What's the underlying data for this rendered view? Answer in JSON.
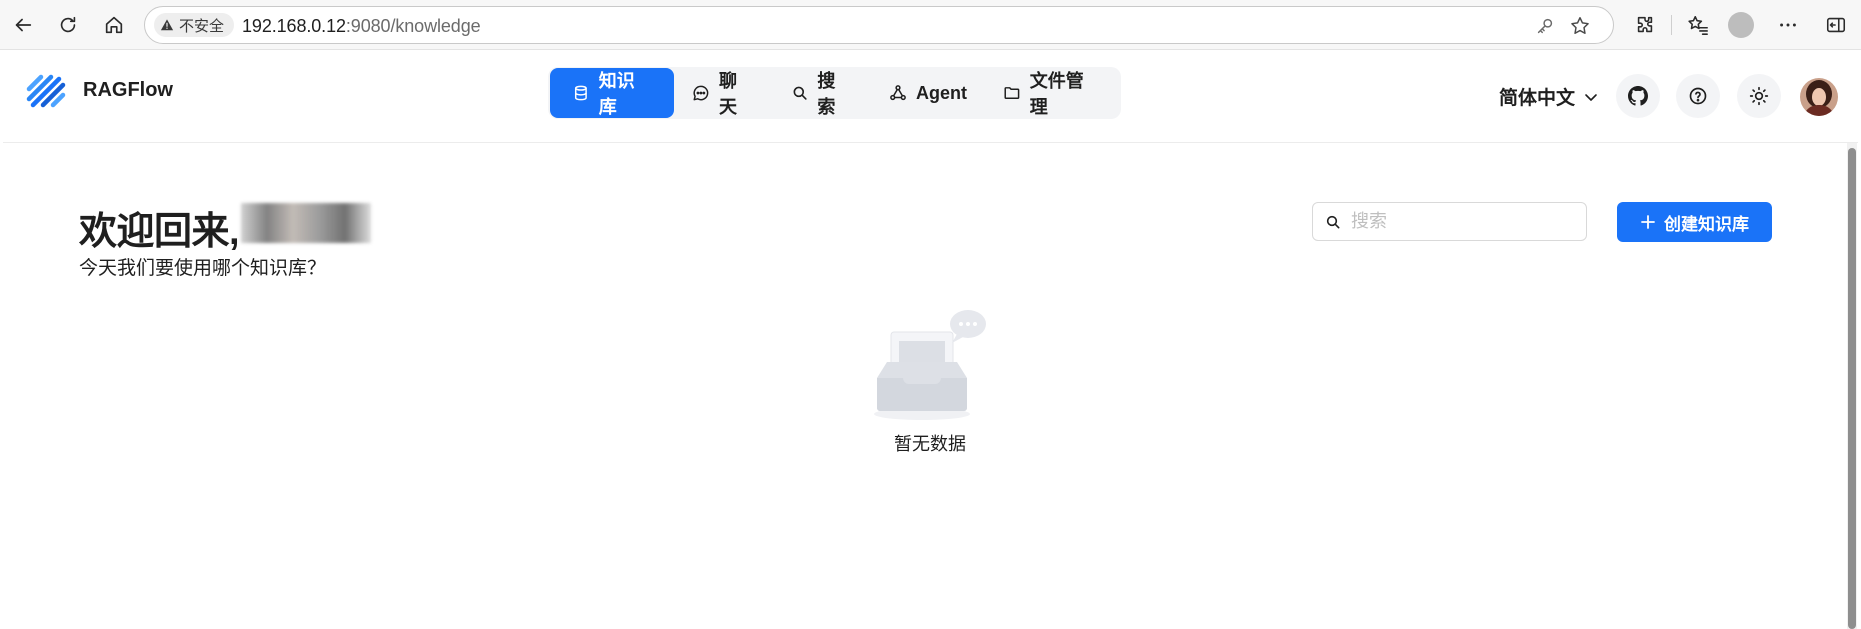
{
  "browser": {
    "security_label": "不安全",
    "url_host": "192.168.0.12",
    "url_path": ":9080/knowledge",
    "icons": [
      "back-icon",
      "reload-icon",
      "home-icon",
      "key-icon",
      "star-icon",
      "extensions-icon",
      "favorites-icon",
      "profile-icon",
      "more-icon",
      "sidebar-icon"
    ]
  },
  "app": {
    "brand_name": "RAGFlow",
    "nav": [
      {
        "label": "知识库",
        "icon": "database-icon",
        "active": true
      },
      {
        "label": "聊天",
        "icon": "chat-icon",
        "active": false
      },
      {
        "label": "搜索",
        "icon": "search-icon",
        "active": false
      },
      {
        "label": "Agent",
        "icon": "agent-icon",
        "active": false
      },
      {
        "label": "文件管理",
        "icon": "folder-icon",
        "active": false
      }
    ],
    "language": "简体中文",
    "accent_color": "#1a73f8"
  },
  "main": {
    "welcome": "欢迎回来, ",
    "subtitle": "今天我们要使用哪个知识库？",
    "search_placeholder": "搜索",
    "search_value": "",
    "create_button": "创建知识库",
    "empty_text": "暂无数据"
  }
}
